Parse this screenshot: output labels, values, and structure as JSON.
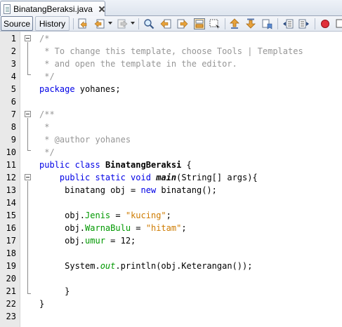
{
  "tab": {
    "title": "BinatangBeraksi.java"
  },
  "toolbar": {
    "source_label": "Source",
    "history_label": "History"
  },
  "colors": {
    "keyword": "#0000e6",
    "comment": "#969696",
    "string": "#ce7b00",
    "field": "#009900"
  },
  "editor": {
    "line_numbers": [
      "1",
      "2",
      "3",
      "4",
      "5",
      "6",
      "7",
      "8",
      "9",
      "10",
      "11",
      "12",
      "13",
      "14",
      "15",
      "16",
      "17",
      "18",
      "19",
      "20",
      "21",
      "22",
      "23"
    ],
    "lines": [
      [
        {
          "t": "/*",
          "c": "cmt"
        }
      ],
      [
        {
          "t": " * To change this template, choose Tools | Templates",
          "c": "cmt"
        }
      ],
      [
        {
          "t": " * and open the template in the editor.",
          "c": "cmt"
        }
      ],
      [
        {
          "t": " */",
          "c": "cmt"
        }
      ],
      [
        {
          "t": "package",
          "c": "kw"
        },
        {
          "t": " yohanes;",
          "c": ""
        }
      ],
      [],
      [
        {
          "t": "/**",
          "c": "cmt"
        }
      ],
      [
        {
          "t": " *",
          "c": "cmt"
        }
      ],
      [
        {
          "t": " * @author yohanes",
          "c": "cmt"
        }
      ],
      [
        {
          "t": " */",
          "c": "cmt"
        }
      ],
      [
        {
          "t": "public class",
          "c": "kw"
        },
        {
          "t": " ",
          "c": ""
        },
        {
          "t": "BinatangBeraksi",
          "c": "cls-name"
        },
        {
          "t": " {",
          "c": ""
        }
      ],
      [
        {
          "t": "    ",
          "c": ""
        },
        {
          "t": "public static void",
          "c": "kw"
        },
        {
          "t": " ",
          "c": ""
        },
        {
          "t": "main",
          "c": "mth"
        },
        {
          "t": "(String[] args){",
          "c": ""
        }
      ],
      [
        {
          "t": "     binatang obj = ",
          "c": ""
        },
        {
          "t": "new",
          "c": "kw"
        },
        {
          "t": " binatang();",
          "c": ""
        }
      ],
      [],
      [
        {
          "t": "     obj.",
          "c": ""
        },
        {
          "t": "Jenis",
          "c": "fld"
        },
        {
          "t": " = ",
          "c": ""
        },
        {
          "t": "\"kucing\"",
          "c": "str"
        },
        {
          "t": ";",
          "c": ""
        }
      ],
      [
        {
          "t": "     obj.",
          "c": ""
        },
        {
          "t": "WarnaBulu",
          "c": "fld"
        },
        {
          "t": " = ",
          "c": ""
        },
        {
          "t": "\"hitam\"",
          "c": "str"
        },
        {
          "t": ";",
          "c": ""
        }
      ],
      [
        {
          "t": "     obj.",
          "c": ""
        },
        {
          "t": "umur",
          "c": "fld"
        },
        {
          "t": " = 12;",
          "c": ""
        }
      ],
      [],
      [
        {
          "t": "     System.",
          "c": ""
        },
        {
          "t": "out",
          "c": "stat"
        },
        {
          "t": ".println(obj.Keterangan());",
          "c": ""
        }
      ],
      [],
      [
        {
          "t": "     }",
          "c": ""
        }
      ],
      [
        {
          "t": "}",
          "c": ""
        }
      ],
      []
    ]
  }
}
